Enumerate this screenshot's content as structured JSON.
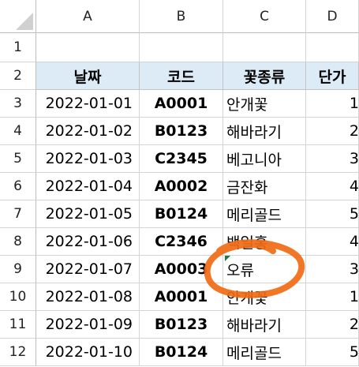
{
  "columns": [
    "A",
    "B",
    "C",
    "D"
  ],
  "rows": [
    "1",
    "2",
    "3",
    "4",
    "5",
    "6",
    "7",
    "8",
    "9",
    "10",
    "11",
    "12"
  ],
  "header": {
    "date": "날짜",
    "code": "코드",
    "flower": "꽃종류",
    "price": "단가"
  },
  "data_rows": [
    {
      "date": "2022-01-01",
      "code": "A0001",
      "flower": "안개꽃",
      "price": "1"
    },
    {
      "date": "2022-01-02",
      "code": "B0123",
      "flower": "해바라기",
      "price": "2"
    },
    {
      "date": "2022-01-03",
      "code": "C2345",
      "flower": "베고니아",
      "price": "3"
    },
    {
      "date": "2022-01-04",
      "code": "A0002",
      "flower": "금잔화",
      "price": "4"
    },
    {
      "date": "2022-01-05",
      "code": "B0124",
      "flower": "메리골드",
      "price": "5"
    },
    {
      "date": "2022-01-06",
      "code": "C2346",
      "flower": "백일홍",
      "price": "4"
    },
    {
      "date": "2022-01-07",
      "code": "A0003",
      "flower": "오류",
      "price": "3"
    },
    {
      "date": "2022-01-08",
      "code": "A0001",
      "flower": "안개꽃",
      "price": "1"
    },
    {
      "date": "2022-01-09",
      "code": "B0123",
      "flower": "해바라기",
      "price": "2"
    },
    {
      "date": "2022-01-10",
      "code": "B0124",
      "flower": "메리골드",
      "price": "5"
    }
  ],
  "colors": {
    "header_fill": "#ddebf7",
    "annotation_circle": "#f06a12",
    "error_indicator": "#1e7b3f"
  },
  "annotation": {
    "type": "hand-drawn-circle",
    "target": "C9"
  }
}
